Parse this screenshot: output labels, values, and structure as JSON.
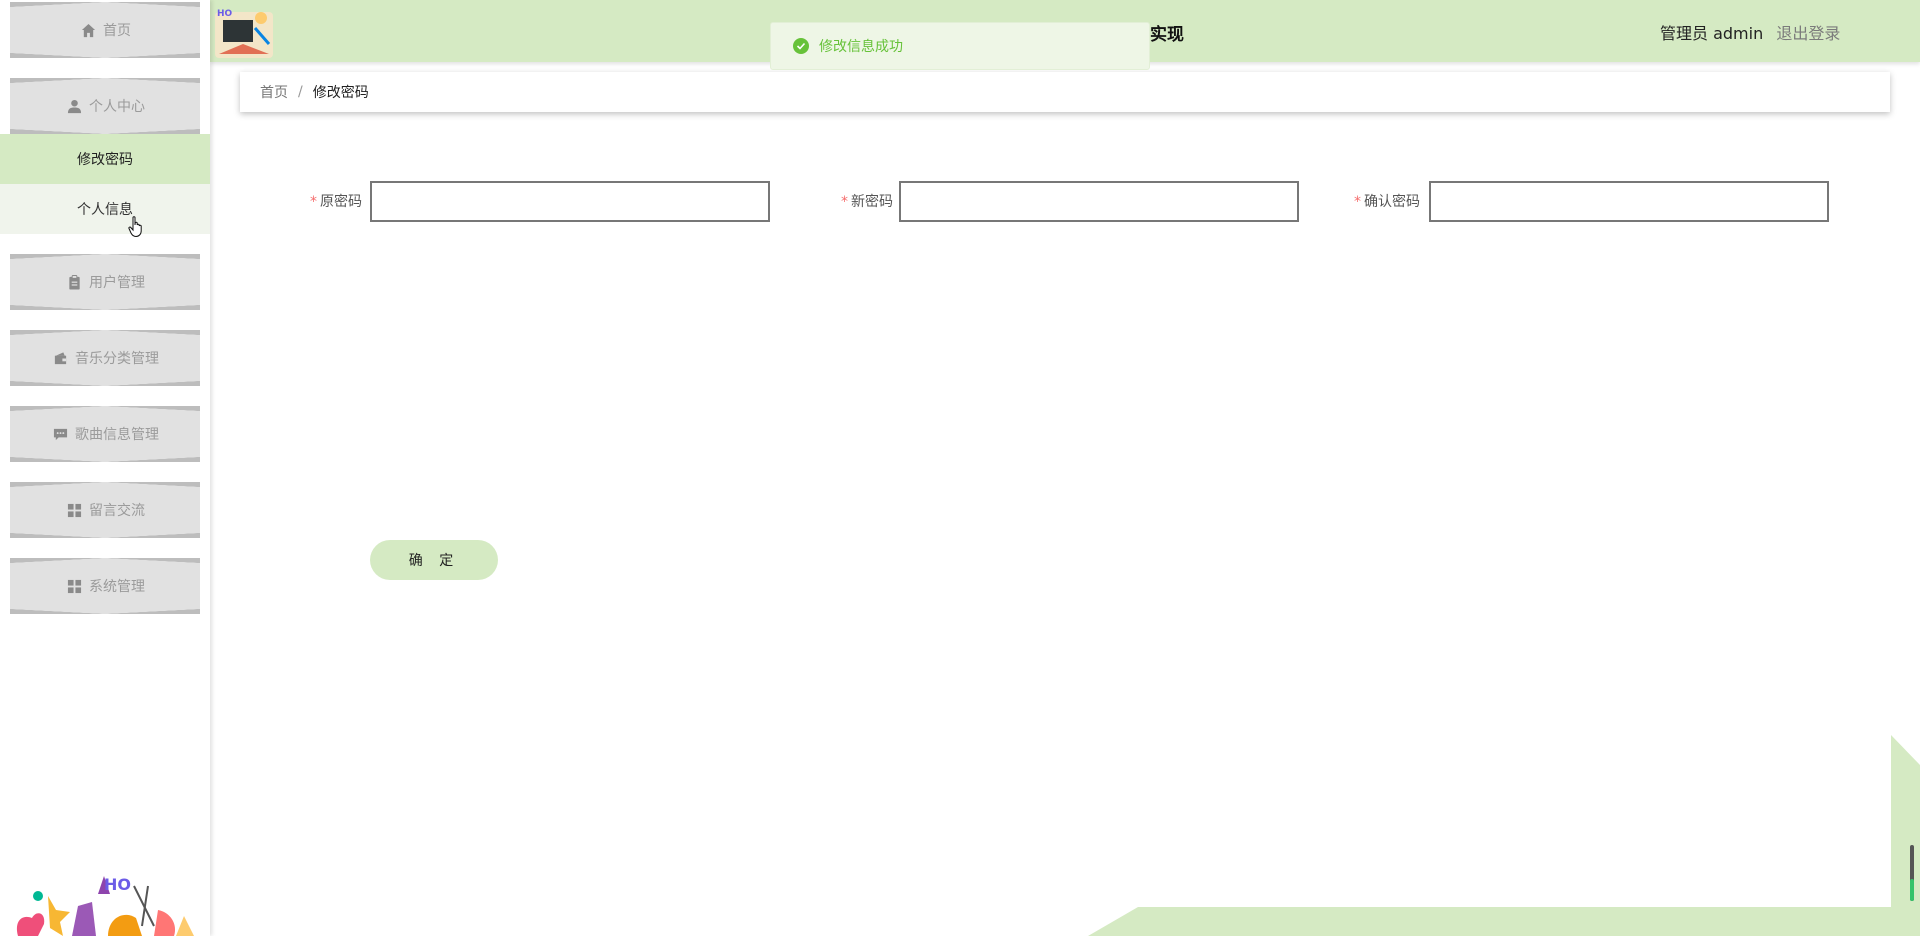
{
  "header": {
    "title": "实现",
    "role_label": "管理员 admin",
    "logout_label": "退出登录"
  },
  "toast": {
    "message": "修改信息成功",
    "status_color": "#67c23a"
  },
  "sidebar": {
    "home": {
      "label": "首页",
      "icon": "home-icon"
    },
    "personal_center": {
      "label": "个人中心",
      "icon": "user-icon"
    },
    "submenu": [
      {
        "label": "修改密码",
        "state": "active"
      },
      {
        "label": "个人信息",
        "state": "hover"
      }
    ],
    "items": [
      {
        "label": "用户管理",
        "icon": "clipboard-icon"
      },
      {
        "label": "音乐分类管理",
        "icon": "wallet-icon"
      },
      {
        "label": "歌曲信息管理",
        "icon": "chat-icon"
      },
      {
        "label": "留言交流",
        "icon": "grid-icon"
      },
      {
        "label": "系统管理",
        "icon": "grid-icon"
      }
    ]
  },
  "breadcrumb": {
    "home": "首页",
    "separator": "/",
    "current": "修改密码"
  },
  "form": {
    "fields": [
      {
        "label": "原密码",
        "value": "",
        "required": true
      },
      {
        "label": "新密码",
        "value": "",
        "required": true
      },
      {
        "label": "确认密码",
        "value": "",
        "required": true
      }
    ],
    "submit_label": "确 定"
  },
  "colors": {
    "accent": "#d5eac3",
    "menu_block": "#e1e1e1",
    "required": "#f56c6c"
  }
}
